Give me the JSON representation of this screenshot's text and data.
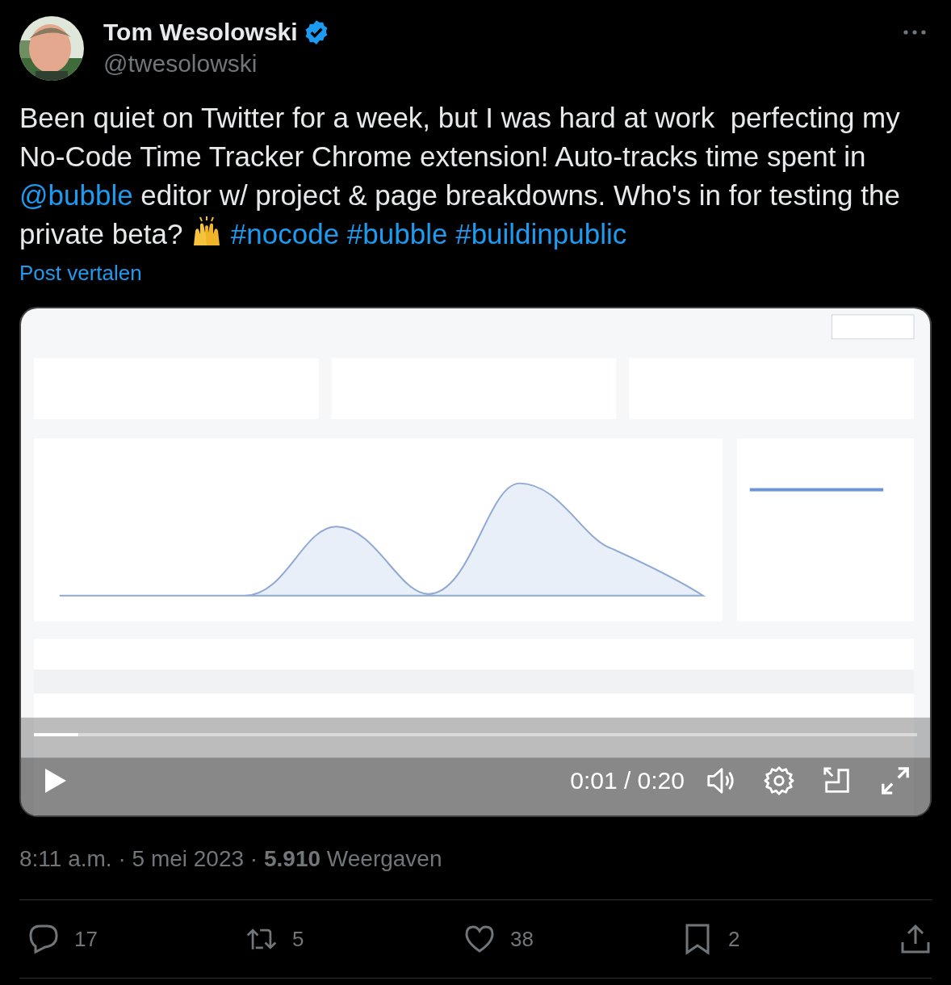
{
  "author": {
    "name": "Tom Wesolowski",
    "verified": true,
    "handle": "@twesolowski"
  },
  "body": [
    {
      "kind": "text",
      "text": "Been quiet on Twitter for a week, but I was hard at work  perfecting my No-Code Time Tracker Chrome extension! Auto-tracks time spent in "
    },
    {
      "kind": "link",
      "text": "@bubble"
    },
    {
      "kind": "text",
      "text": " editor w/ project & page breakdowns. Who's in for testing the private beta? "
    },
    {
      "kind": "emoji"
    },
    {
      "kind": "link",
      "text": "#nocode",
      "space_before": true
    },
    {
      "kind": "link",
      "text": "#bubble",
      "space_before": true
    },
    {
      "kind": "link",
      "text": "#buildinpublic",
      "space_before": true
    }
  ],
  "translate": "Post vertalen",
  "video": {
    "kind": "picture",
    "progress": {
      "level": 0.05
    },
    "time": "0:01 / 0:20"
  },
  "meta": "8:11 a.m. · 5 mei 2023 · **5.910** Weergaven",
  "actions": [
    {
      "kind": "reply",
      "count": "17"
    },
    {
      "kind": "repost",
      "count": "5"
    },
    {
      "kind": "like",
      "count": "38"
    },
    {
      "kind": "bookmark",
      "count": "2"
    },
    {
      "kind": "share"
    }
  ]
}
